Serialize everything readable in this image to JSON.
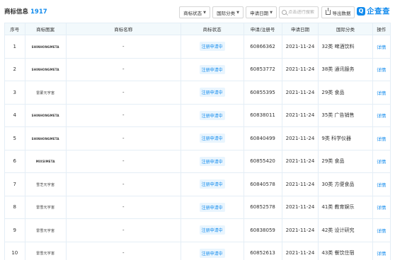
{
  "header": {
    "title": "商标信息",
    "count": "1917",
    "filters": [
      {
        "label": "商标状态"
      },
      {
        "label": "国际分类"
      },
      {
        "label": "申请日期"
      }
    ],
    "search_placeholder": "点击进行搜索",
    "export_label": "导出数据",
    "logo_mark": "Q",
    "logo_text": "企查查"
  },
  "table": {
    "columns": [
      "序号",
      "商标图案",
      "商标名称",
      "商标状态",
      "申请/注册号",
      "申请日期",
      "国际分类",
      "操作"
    ],
    "rows": [
      {
        "no": "1",
        "brand": "SHINHONGMETA",
        "name": "-",
        "status": "注册申请中",
        "reg": "60866362",
        "date": "2021-11-24",
        "cls": "32类 啤酒饮料",
        "op": "详情"
      },
      {
        "no": "2",
        "brand": "SHINHONGMETA",
        "name": "-",
        "status": "注册申请中",
        "reg": "60853772",
        "date": "2021-11-24",
        "cls": "38类 通讯服务",
        "op": "详情"
      },
      {
        "no": "3",
        "brand": "雷蒙元宇宙",
        "name": "-",
        "status": "注册申请中",
        "reg": "60855395",
        "date": "2021-11-24",
        "cls": "29类 食品",
        "op": "详情"
      },
      {
        "no": "4",
        "brand": "SHINHONGMETA",
        "name": "-",
        "status": "注册申请中",
        "reg": "60838011",
        "date": "2021-11-24",
        "cls": "35类 广告销售",
        "op": "详情"
      },
      {
        "no": "5",
        "brand": "SHINHONGMETA",
        "name": "-",
        "status": "注册申请中",
        "reg": "60840499",
        "date": "2021-11-24",
        "cls": "9类 科学仪器",
        "op": "详情"
      },
      {
        "no": "6",
        "brand": "MIXSIMETA",
        "name": "-",
        "status": "注册申请中",
        "reg": "60855420",
        "date": "2021-11-24",
        "cls": "29类 食品",
        "op": "详情"
      },
      {
        "no": "7",
        "brand": "雪芝元宇宙",
        "name": "-",
        "status": "注册申请中",
        "reg": "60840578",
        "date": "2021-11-24",
        "cls": "30类 方便食品",
        "op": "详情"
      },
      {
        "no": "8",
        "brand": "雷雪元宇宙",
        "name": "-",
        "status": "注册申请中",
        "reg": "60852578",
        "date": "2021-11-24",
        "cls": "41类 教育娱乐",
        "op": "详情"
      },
      {
        "no": "9",
        "brand": "雷雪元宇宙",
        "name": "-",
        "status": "注册申请中",
        "reg": "60838059",
        "date": "2021-11-24",
        "cls": "42类 设计研究",
        "op": "详情"
      },
      {
        "no": "10",
        "brand": "雷雪元宇宙",
        "name": "-",
        "status": "注册申请中",
        "reg": "60852613",
        "date": "2021-11-24",
        "cls": "43类 餐饮住宿",
        "op": "详情"
      }
    ]
  },
  "colors": {
    "accent": "#128bed",
    "header_bg": "#f2f9fc",
    "status_bg": "#e9f5fe"
  }
}
